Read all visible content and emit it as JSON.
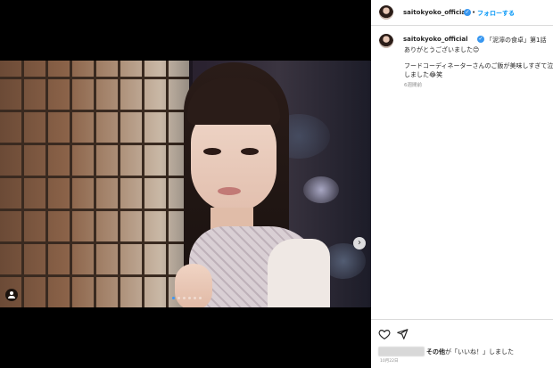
{
  "account": {
    "username": "saitokyoko_official",
    "separator": "•",
    "follow_label": "フォローする"
  },
  "caption": {
    "line1": "「泥濘の食卓」第1話",
    "line2": "ありがとうございました😊",
    "line3": "フードコーディネーターさんのご飯が美味しすぎて泣",
    "line4": "しました😂笑",
    "time_ago": "6週間前"
  },
  "carousel": {
    "slide_count": 6,
    "active_index": 0,
    "next_arrow": "›"
  },
  "actions": {
    "like_icon": "heart-icon",
    "share_icon": "share-icon"
  },
  "likes": {
    "suffix_bold": "その他",
    "suffix_text": "が「いいね！」しました"
  },
  "post_date": "10月22日",
  "colors": {
    "accent": "#0095f6",
    "verified": "#3897f0",
    "divider": "#dbdbdb",
    "text": "#262626",
    "muted": "#8e8e8e"
  }
}
